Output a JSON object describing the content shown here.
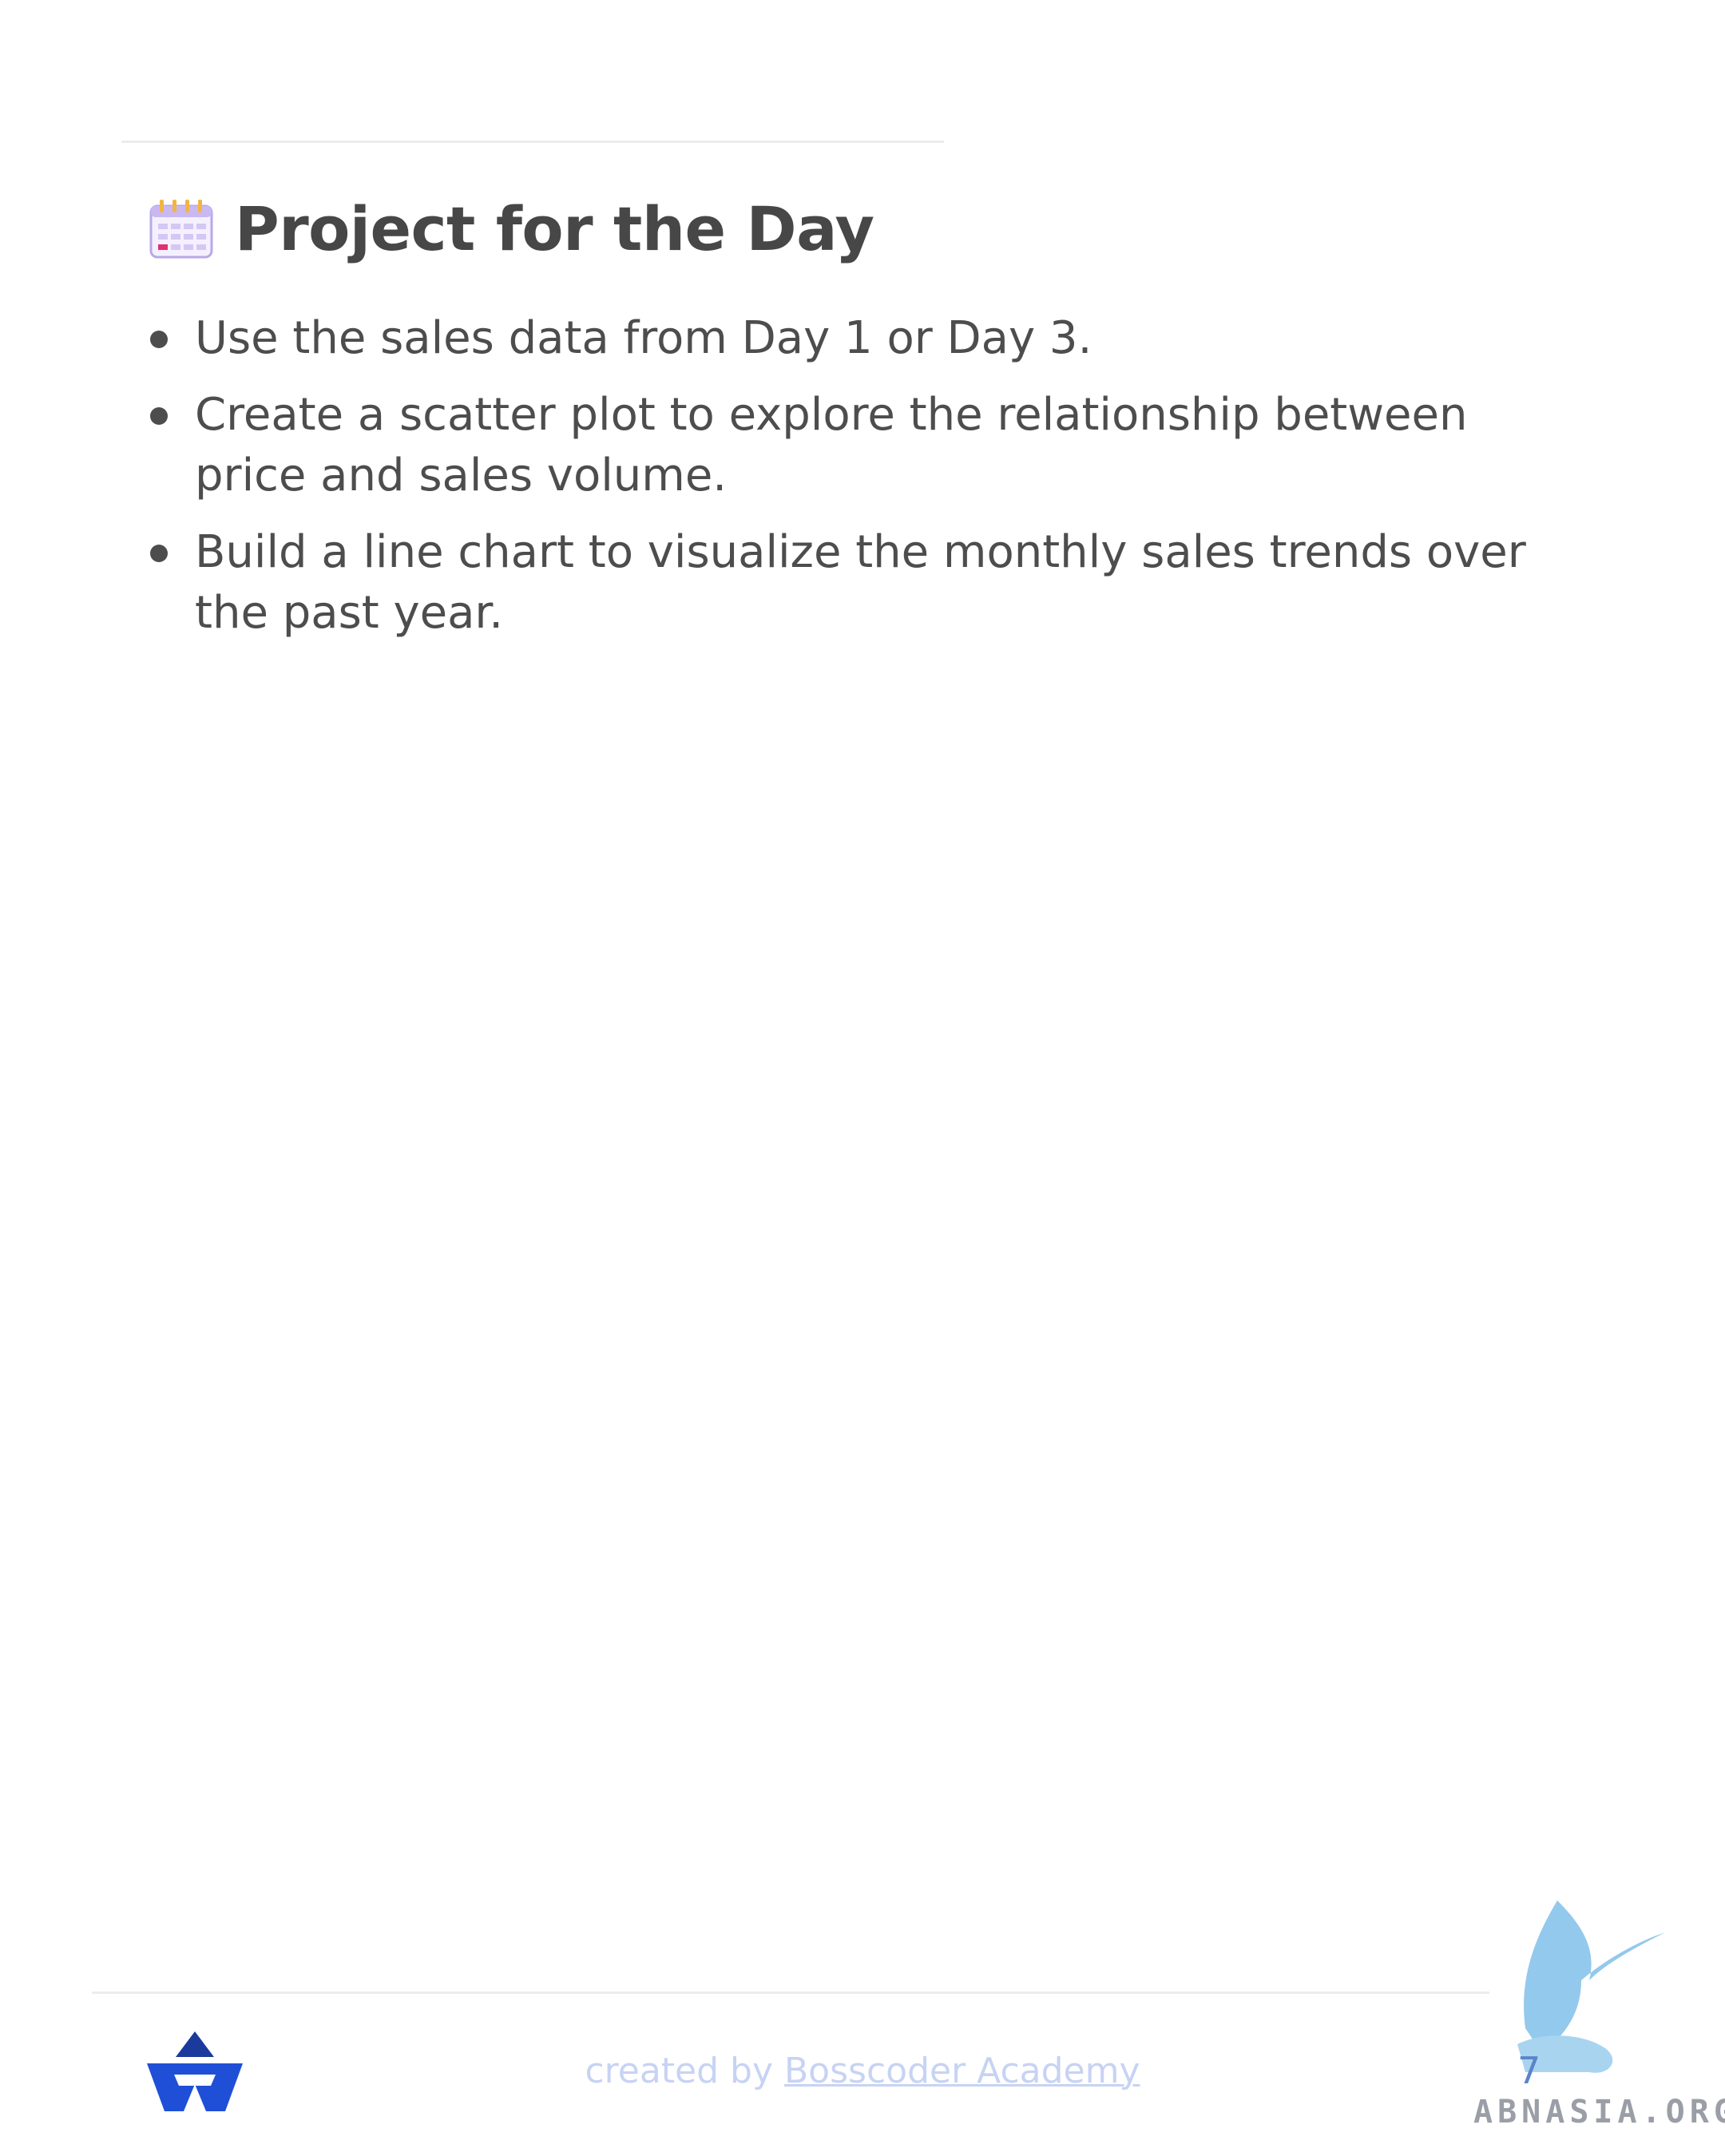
{
  "section": {
    "icon": "calendar-icon",
    "title": "Project for the Day"
  },
  "bullets": [
    "Use the sales data from Day 1 or Day 3.",
    "Create a scatter plot to explore the relationship between price and sales volume.",
    "Build a line chart to visualize the monthly sales trends over the past year."
  ],
  "footer": {
    "logo": "bosscoder-logo-icon",
    "credit_prefix": "created by ",
    "credit_link": "Bosscoder Academy",
    "page_number": "7"
  },
  "watermark": {
    "icon": "griffin-watermark-icon",
    "text": "ABNASIA.ORG"
  },
  "colors": {
    "text": "#4d4d4d",
    "footer_credit": "#c7d3f3",
    "logo_blue": "#1f4fd6",
    "watermark_blue": "#6fb7e6"
  }
}
